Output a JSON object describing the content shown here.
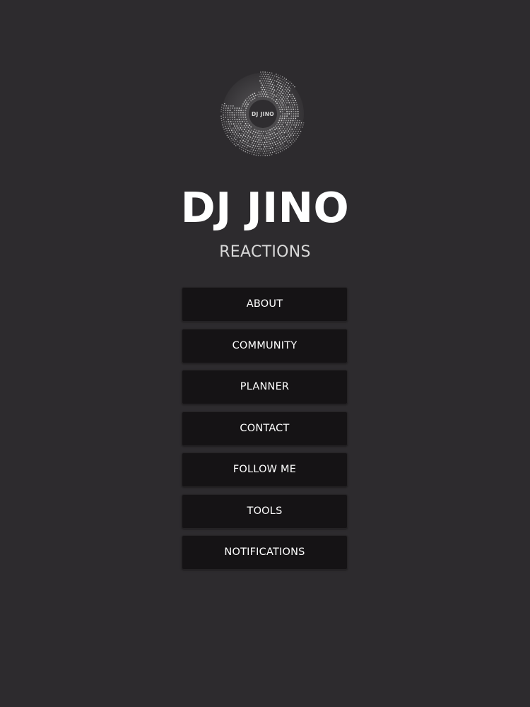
{
  "app": {
    "logo_text": "DJ JINO",
    "title": "DJ JINO",
    "subtitle": "REACTIONS"
  },
  "menu": {
    "items": [
      {
        "label": "ABOUT"
      },
      {
        "label": "COMMUNITY"
      },
      {
        "label": "PLANNER"
      },
      {
        "label": "CONTACT"
      },
      {
        "label": "FOLLOW ME"
      },
      {
        "label": "TOOLS"
      },
      {
        "label": "NOTIFICATIONS"
      }
    ]
  },
  "colors": {
    "background": "#2d2b2e",
    "button": "#151315",
    "text": "#ffffff",
    "subtitle": "#d9d9d9"
  },
  "icons": {
    "logo": "vinyl-disc-logo-icon"
  }
}
